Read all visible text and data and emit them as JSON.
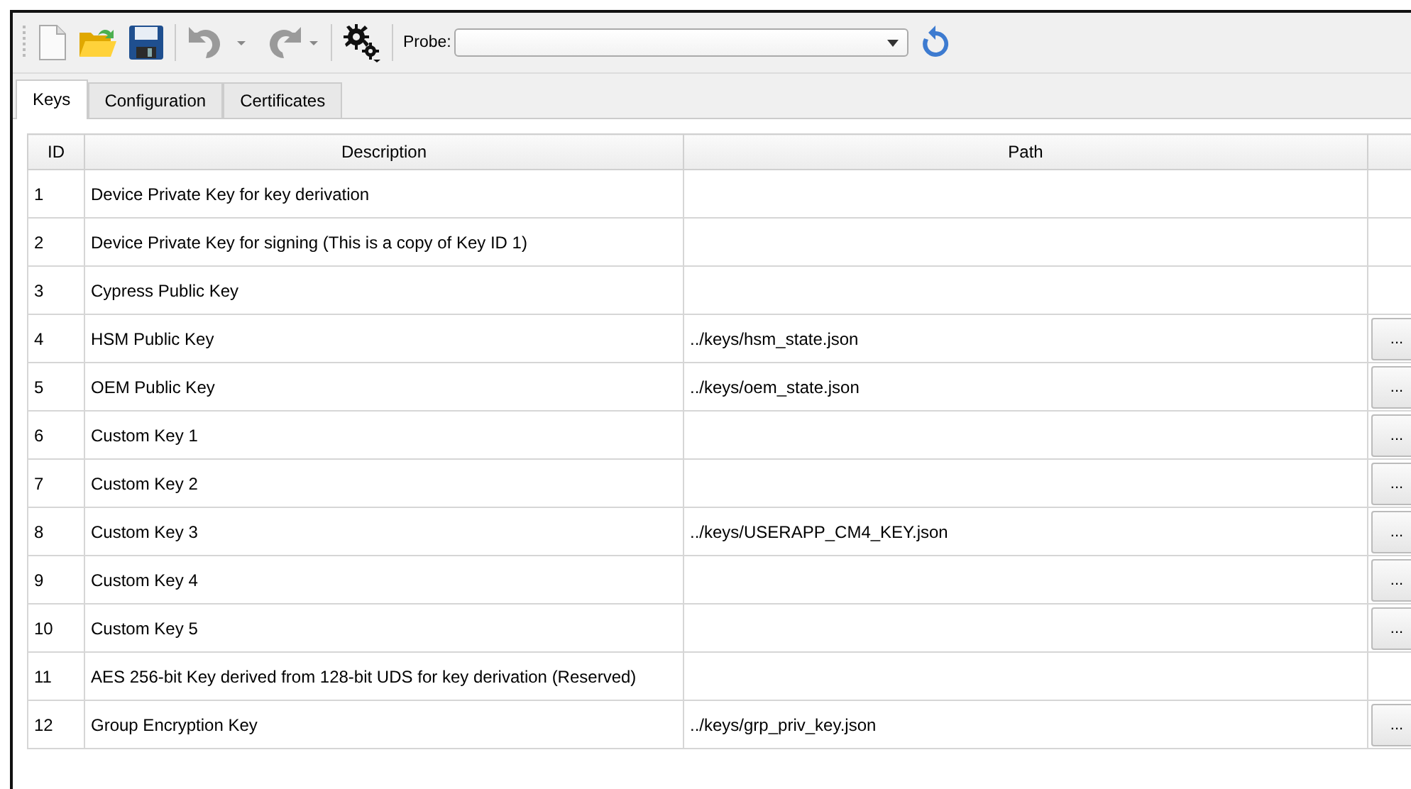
{
  "toolbar": {
    "probe_label": "Probe:"
  },
  "tabs": [
    {
      "label": "Keys",
      "selected": true
    },
    {
      "label": "Configuration",
      "selected": false
    },
    {
      "label": "Certificates",
      "selected": false
    }
  ],
  "table": {
    "columns": [
      "ID",
      "Description",
      "Path"
    ],
    "rows": [
      {
        "id": "1",
        "description": "Device Private Key for key derivation"
      },
      {
        "id": "2",
        "description": "Device Private Key for signing (This is a copy of Key ID 1)"
      },
      {
        "id": "3",
        "description": "Cypress Public Key"
      },
      {
        "id": "4",
        "description": "HSM Public Key",
        "path": "../keys/hsm_state.json",
        "button": "..."
      },
      {
        "id": "5",
        "description": "OEM Public Key",
        "path": "../keys/oem_state.json",
        "button": "..."
      },
      {
        "id": "6",
        "description": "Custom Key 1",
        "button": "..."
      },
      {
        "id": "7",
        "description": "Custom Key 2",
        "button": "..."
      },
      {
        "id": "8",
        "description": "Custom Key 3",
        "path": "../keys/USERAPP_CM4_KEY.json",
        "button": "..."
      },
      {
        "id": "9",
        "description": "Custom Key 4",
        "button": "..."
      },
      {
        "id": "10",
        "description": "Custom Key 5",
        "button": "..."
      },
      {
        "id": "11",
        "description": "AES 256-bit Key derived from 128-bit UDS for key derivation (Reserved)"
      },
      {
        "id": "12",
        "description": "Group Encryption Key",
        "path": "../keys/grp_priv_key.json",
        "button": "..."
      }
    ]
  }
}
